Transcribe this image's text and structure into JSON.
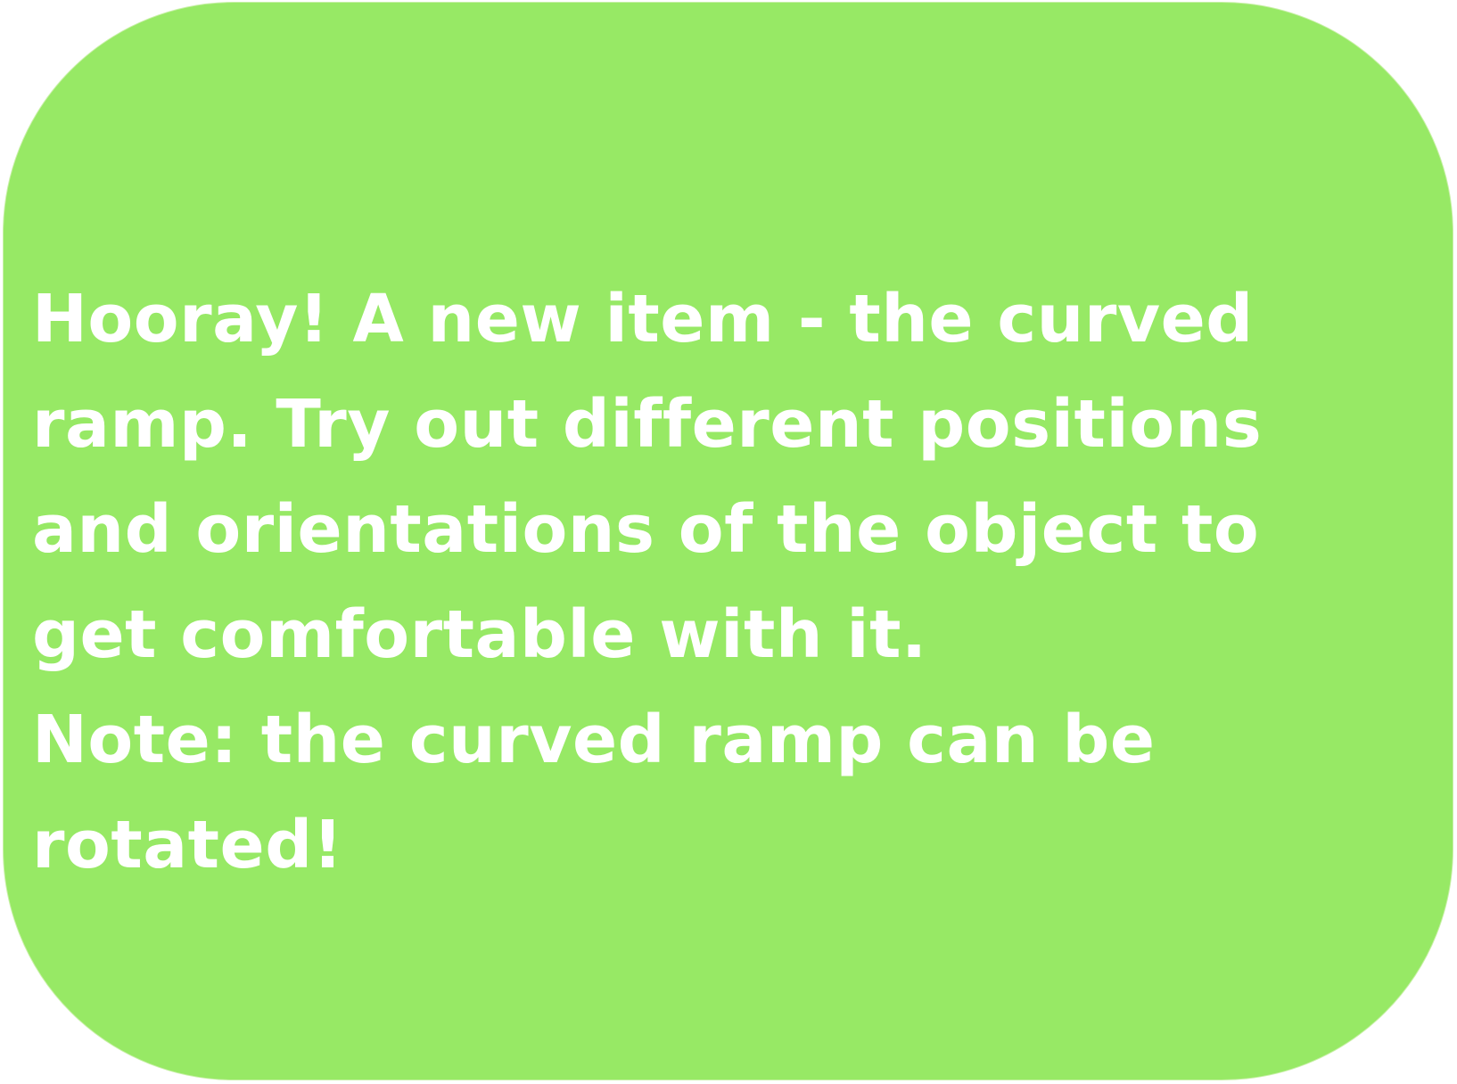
{
  "colors": {
    "background": "#97e965",
    "text": "#ffffff"
  },
  "message": {
    "lines": [
      "Hooray! A new item - the curved",
      "ramp. Try out different positions",
      "and orientations of the object to",
      "get comfortable with it.",
      "Note: the curved ramp can be",
      "rotated!"
    ]
  }
}
